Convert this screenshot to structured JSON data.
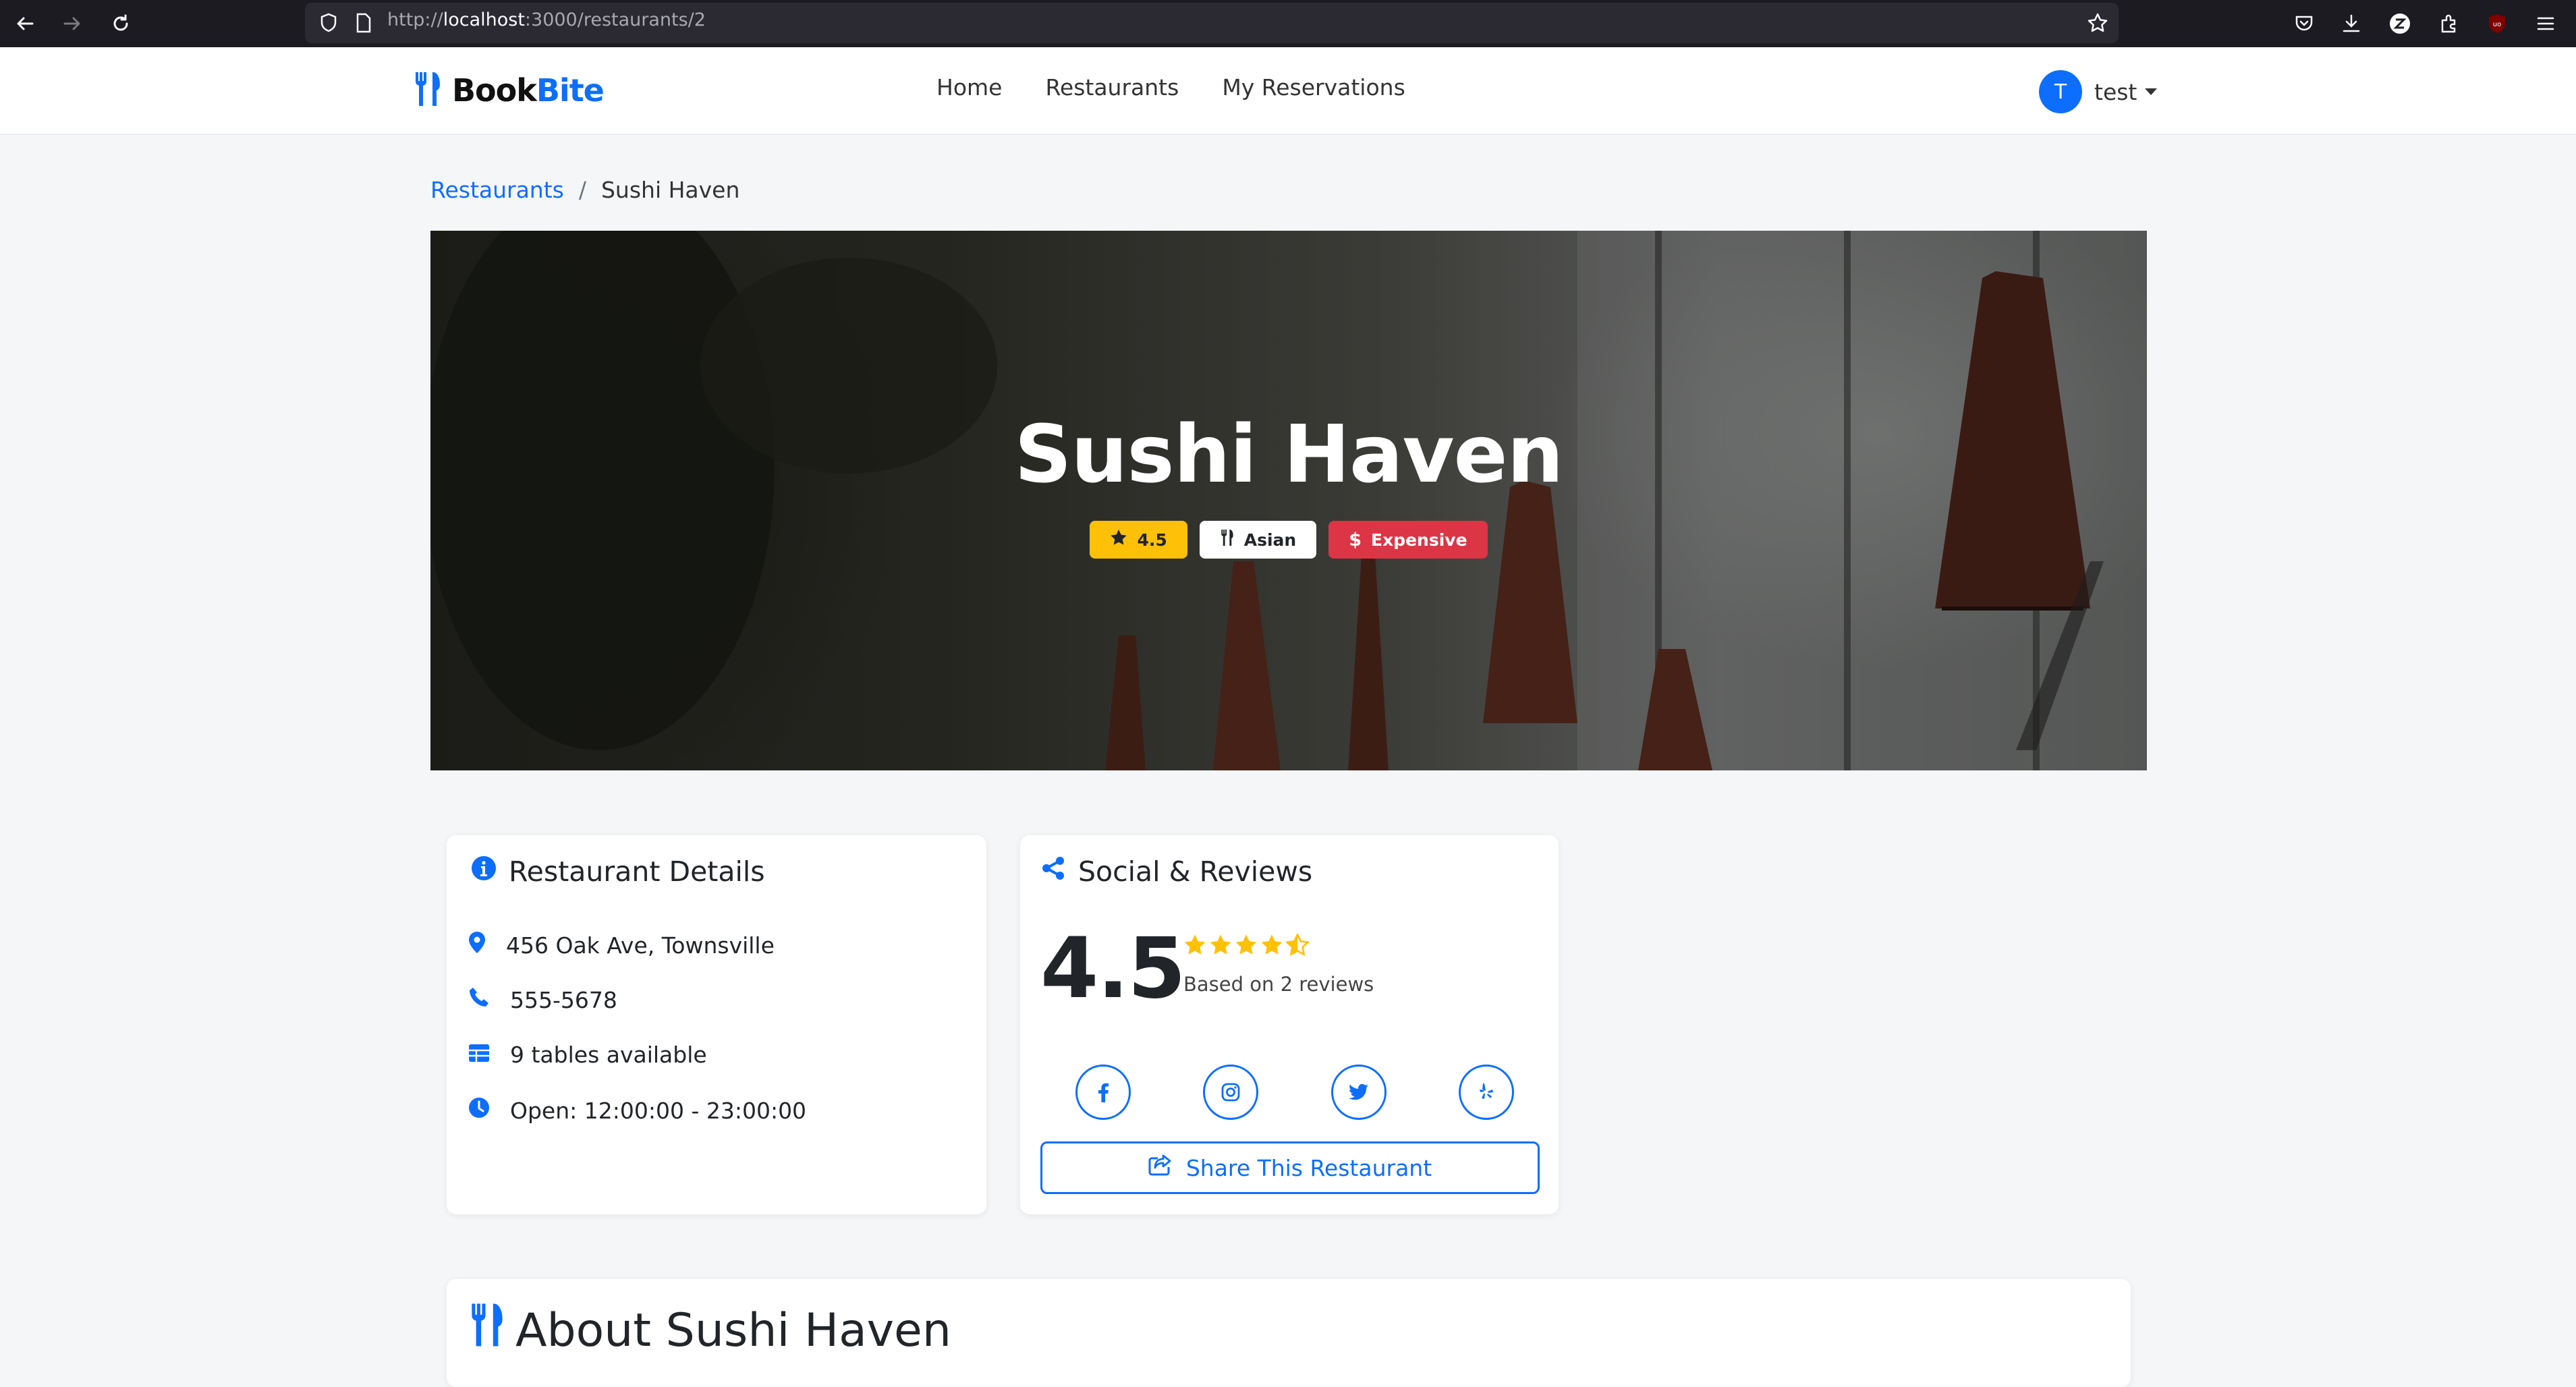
{
  "browser": {
    "url_prefix": "http://",
    "url_host": "localhost",
    "url_path": ":3000/restaurants/2"
  },
  "navbar": {
    "brand_part1": "Book",
    "brand_part2": "Bite",
    "links": [
      "Home",
      "Restaurants",
      "My Reservations"
    ],
    "user_initial": "T",
    "user_name": "test"
  },
  "breadcrumb": {
    "parent": "Restaurants",
    "separator": "/",
    "current": "Sushi Haven"
  },
  "hero": {
    "title": "Sushi Haven",
    "rating": "4.5",
    "cuisine": "Asian",
    "price": "Expensive"
  },
  "details": {
    "title": "Restaurant Details",
    "address": "456 Oak Ave, Townsville",
    "phone": "555-5678",
    "tables": "9 tables available",
    "hours": "Open: 12:00:00 - 23:00:00"
  },
  "social": {
    "title": "Social & Reviews",
    "rating": "4.5",
    "stars_value": 4.5,
    "reviews_text": "Based on 2 reviews",
    "networks": [
      "facebook",
      "instagram",
      "twitter",
      "yelp"
    ],
    "share_label": "Share This Restaurant"
  },
  "about": {
    "title": "About Sushi Haven"
  },
  "colors": {
    "primary": "#0d6efd",
    "warning": "#ffc107",
    "danger": "#dc3545"
  }
}
